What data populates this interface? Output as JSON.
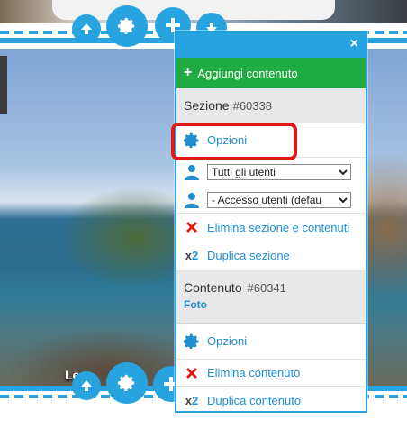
{
  "caption": "Le...",
  "panel": {
    "close_label": "×",
    "add_button": {
      "label": "Aggiungi contenuto",
      "icon": "plus-icon"
    },
    "section": {
      "title": "Sezione",
      "id": "#60338",
      "options_label": "Opzioni",
      "users_select": {
        "selected": "Tutti gli utenti"
      },
      "access_select": {
        "selected": "- Accesso utenti (defau"
      },
      "delete_label": "Elimina sezione e contenuti",
      "duplicate_label": "Duplica sezione"
    },
    "content": {
      "title": "Contenuto",
      "id": "#60341",
      "type": "Foto",
      "options_label": "Opzioni",
      "delete_label": "Elimina contenuto",
      "duplicate_label": "Duplica contenuto"
    }
  },
  "icons": {
    "x2_prefix": "x",
    "x2_number": "2"
  },
  "colors": {
    "accent": "#27a3e0",
    "add_green": "#1fab3f",
    "delete_red": "#e01919",
    "highlight": "#e01919"
  }
}
